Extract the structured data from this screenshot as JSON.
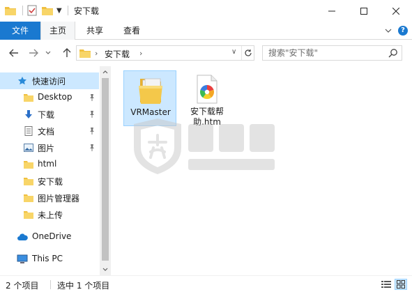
{
  "window": {
    "title": "安下载"
  },
  "ribbon": {
    "tabs": [
      {
        "label": "文件"
      },
      {
        "label": "主页"
      },
      {
        "label": "共享"
      },
      {
        "label": "查看"
      }
    ],
    "help_label": "?"
  },
  "address": {
    "segments": [
      "安下载"
    ]
  },
  "search": {
    "placeholder": "搜索\"安下载\""
  },
  "navigation": {
    "quick_access": {
      "label": "快速访问"
    },
    "items": [
      {
        "label": "Desktop",
        "icon": "folder-blue-icon",
        "pinned": true
      },
      {
        "label": "下载",
        "icon": "download-arrow-icon",
        "pinned": true
      },
      {
        "label": "文档",
        "icon": "document-icon",
        "pinned": true
      },
      {
        "label": "图片",
        "icon": "picture-icon",
        "pinned": true
      },
      {
        "label": "html",
        "icon": "folder-icon",
        "pinned": false
      },
      {
        "label": "安下载",
        "icon": "folder-icon",
        "pinned": false
      },
      {
        "label": "图片管理器",
        "icon": "folder-icon",
        "pinned": false
      },
      {
        "label": "未上传",
        "icon": "folder-icon",
        "pinned": false
      }
    ],
    "onedrive": {
      "label": "OneDrive"
    },
    "thispc": {
      "label": "This PC"
    }
  },
  "files": [
    {
      "name": "VRMaster",
      "type": "folder",
      "selected": true
    },
    {
      "name": "安下载帮助.htm",
      "line1": "安下载帮",
      "line2": "助.htm",
      "type": "htm",
      "selected": false
    }
  ],
  "status": {
    "count": "2 个项目",
    "selection": "选中 1 个项目"
  },
  "colors": {
    "accent": "#1a79d0",
    "selection": "#cce8ff",
    "folder": "#f0c040"
  }
}
